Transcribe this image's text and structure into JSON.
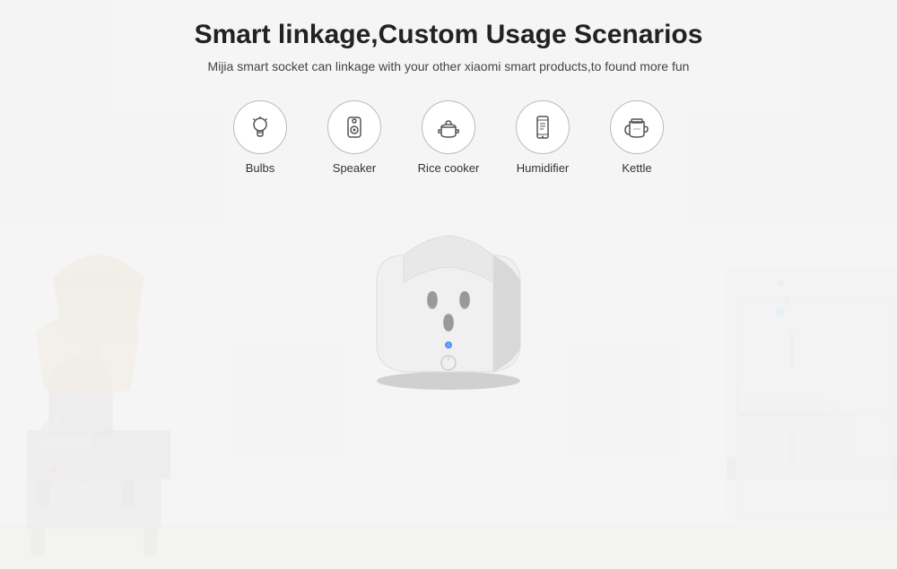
{
  "page": {
    "background_color": "#1c1c1c",
    "title": "Smart linkage,Custom Usage Scenarios",
    "subtitle": "Mijia smart socket can linkage with your other xiaomi smart products,to found more fun",
    "icons": [
      {
        "id": "bulbs",
        "label": "Bulbs",
        "symbol": "💡"
      },
      {
        "id": "speaker",
        "label": "Speaker",
        "symbol": "🔊"
      },
      {
        "id": "rice_cooker",
        "label": "Rice cooker",
        "symbol": "🍚"
      },
      {
        "id": "humidifier",
        "label": "Humidifier",
        "symbol": "📱"
      },
      {
        "id": "kettle",
        "label": "Kettle",
        "symbol": "🫖"
      }
    ]
  }
}
